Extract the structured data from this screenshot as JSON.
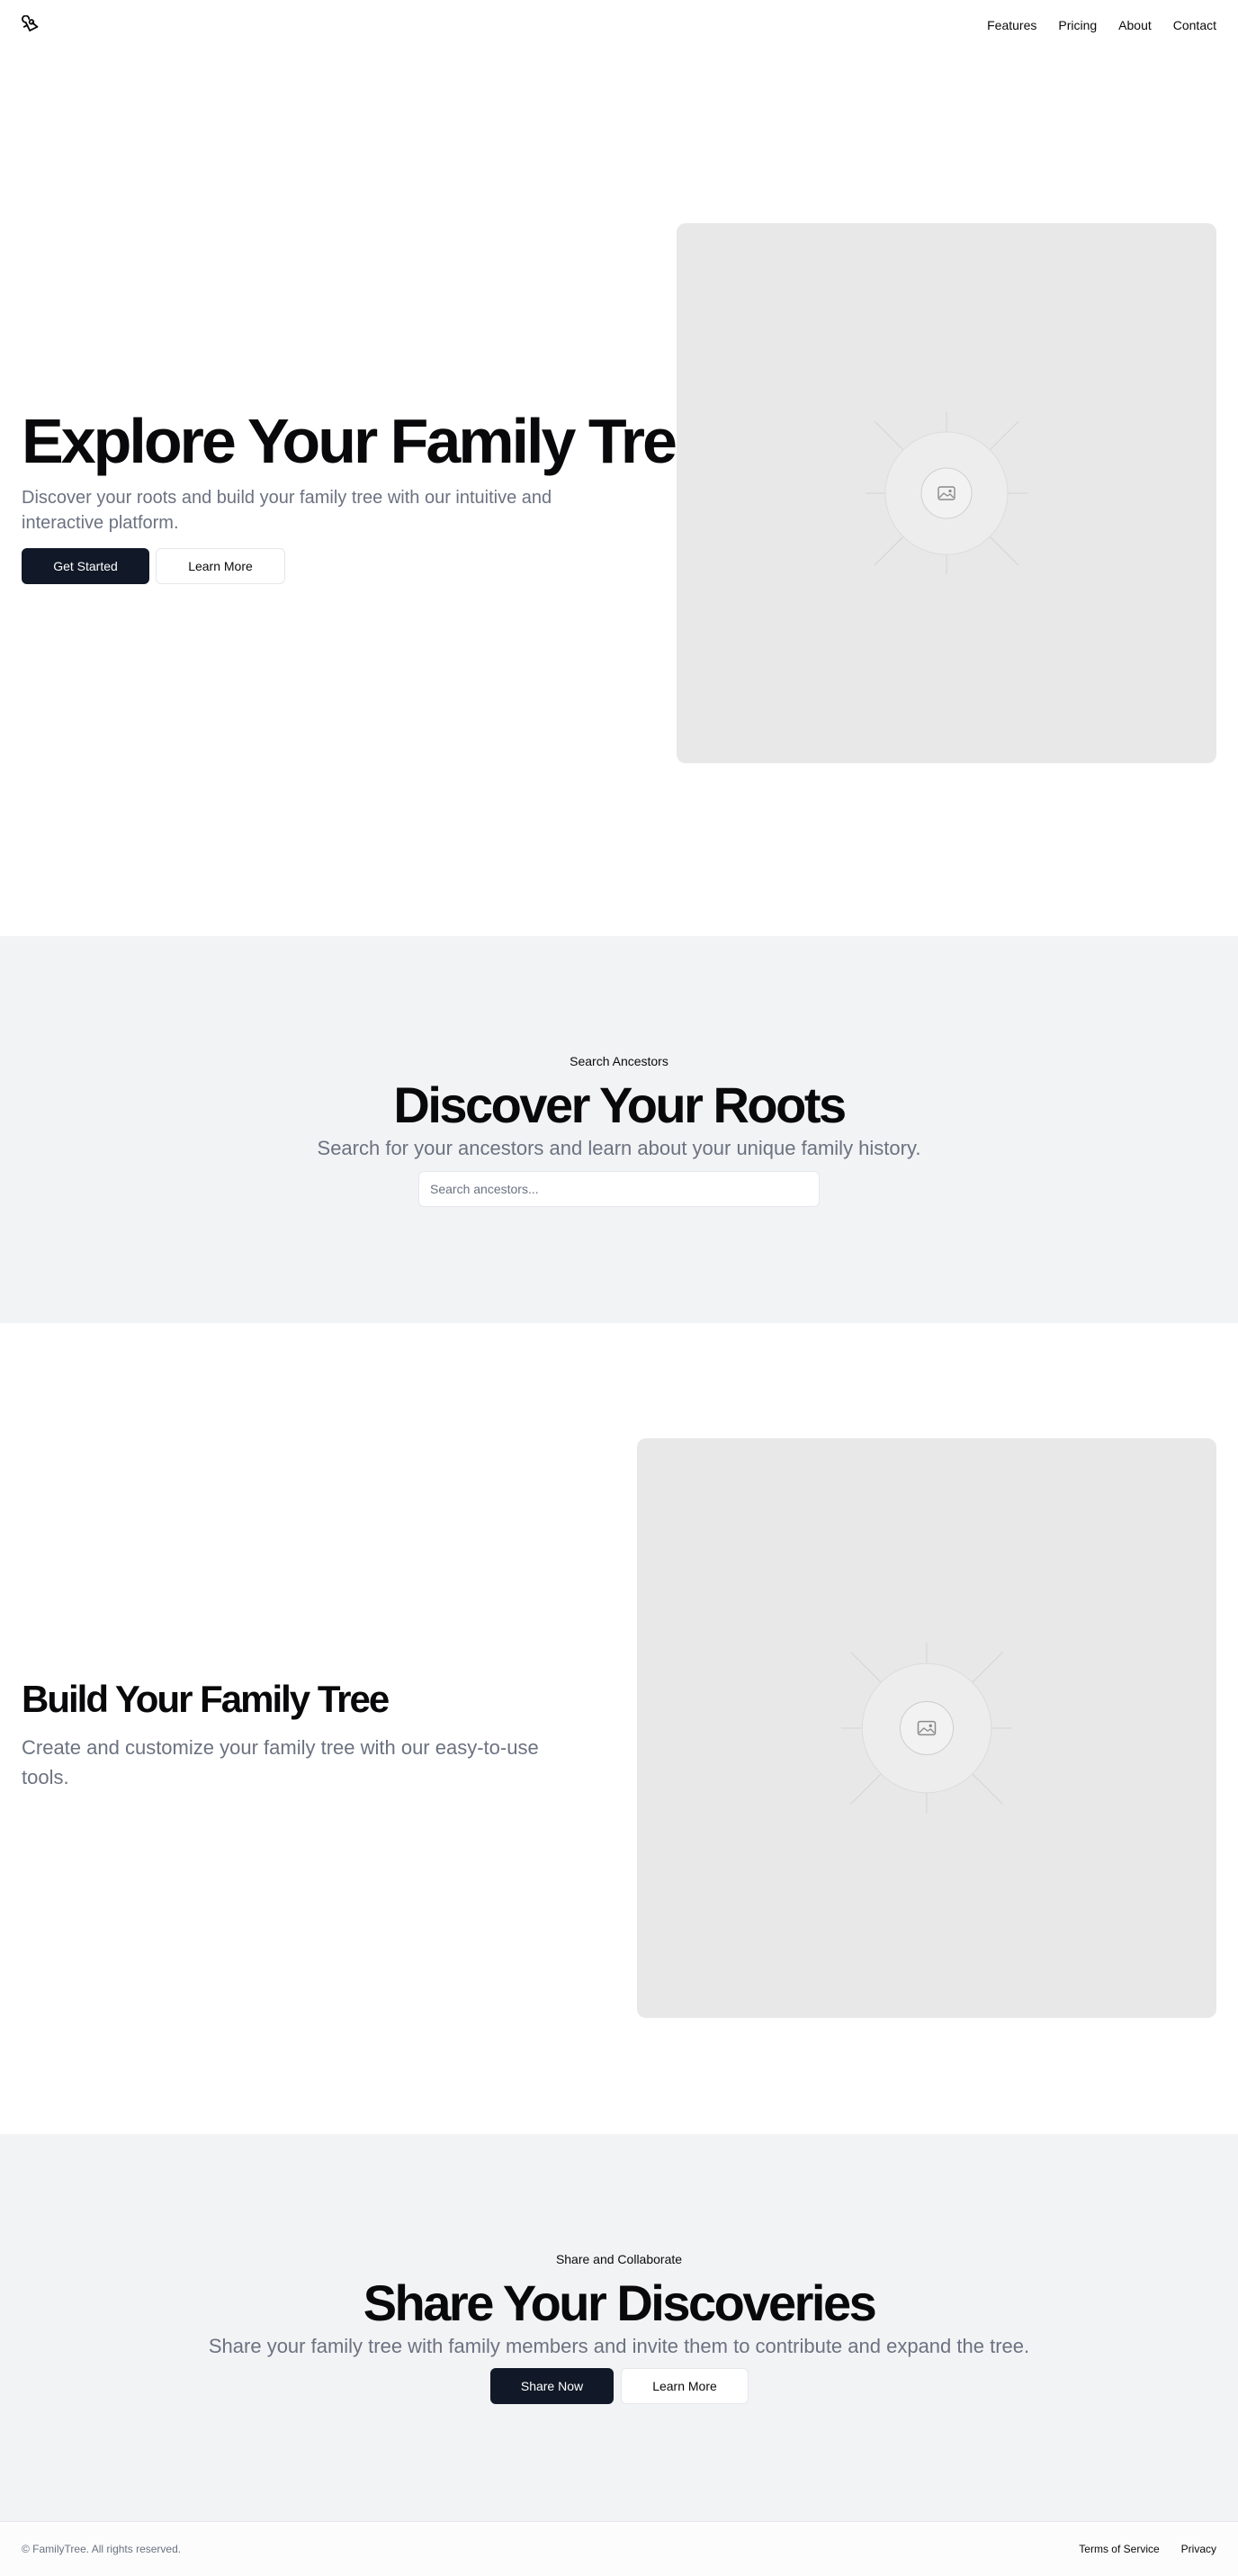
{
  "header": {
    "logo_icon": "family-tree-logo-icon",
    "nav": [
      "Features",
      "Pricing",
      "About",
      "Contact"
    ]
  },
  "hero": {
    "title": "Explore Your Family Tree",
    "subtitle": "Discover your roots and build your family tree with our intuitive and interactive platform.",
    "primary_button": "Get Started",
    "secondary_button": "Learn More",
    "image_icon": "image-placeholder-icon"
  },
  "search_section": {
    "eyebrow": "Search Ancestors",
    "title": "Discover Your Roots",
    "subtitle": "Search for your ancestors and learn about your unique family history.",
    "search": {
      "placeholder": "Search ancestors...",
      "value": ""
    }
  },
  "build_section": {
    "title": "Build Your Family Tree",
    "subtitle": "Create and customize your family tree with our easy-to-use tools.",
    "image_icon": "image-placeholder-icon"
  },
  "share_section": {
    "eyebrow": "Share and Collaborate",
    "title": "Share Your Discoveries",
    "subtitle": "Share your family tree with family members and invite them to contribute and expand the tree.",
    "primary_button": "Share Now",
    "secondary_button": "Learn More"
  },
  "footer": {
    "copyright": "© FamilyTree. All rights reserved.",
    "links": [
      "Terms of Service",
      "Privacy"
    ]
  },
  "colors": {
    "primary": "#111827",
    "muted_text": "#6b7280",
    "band_background": "#f2f3f5",
    "placeholder_background": "#e8e8e8"
  }
}
